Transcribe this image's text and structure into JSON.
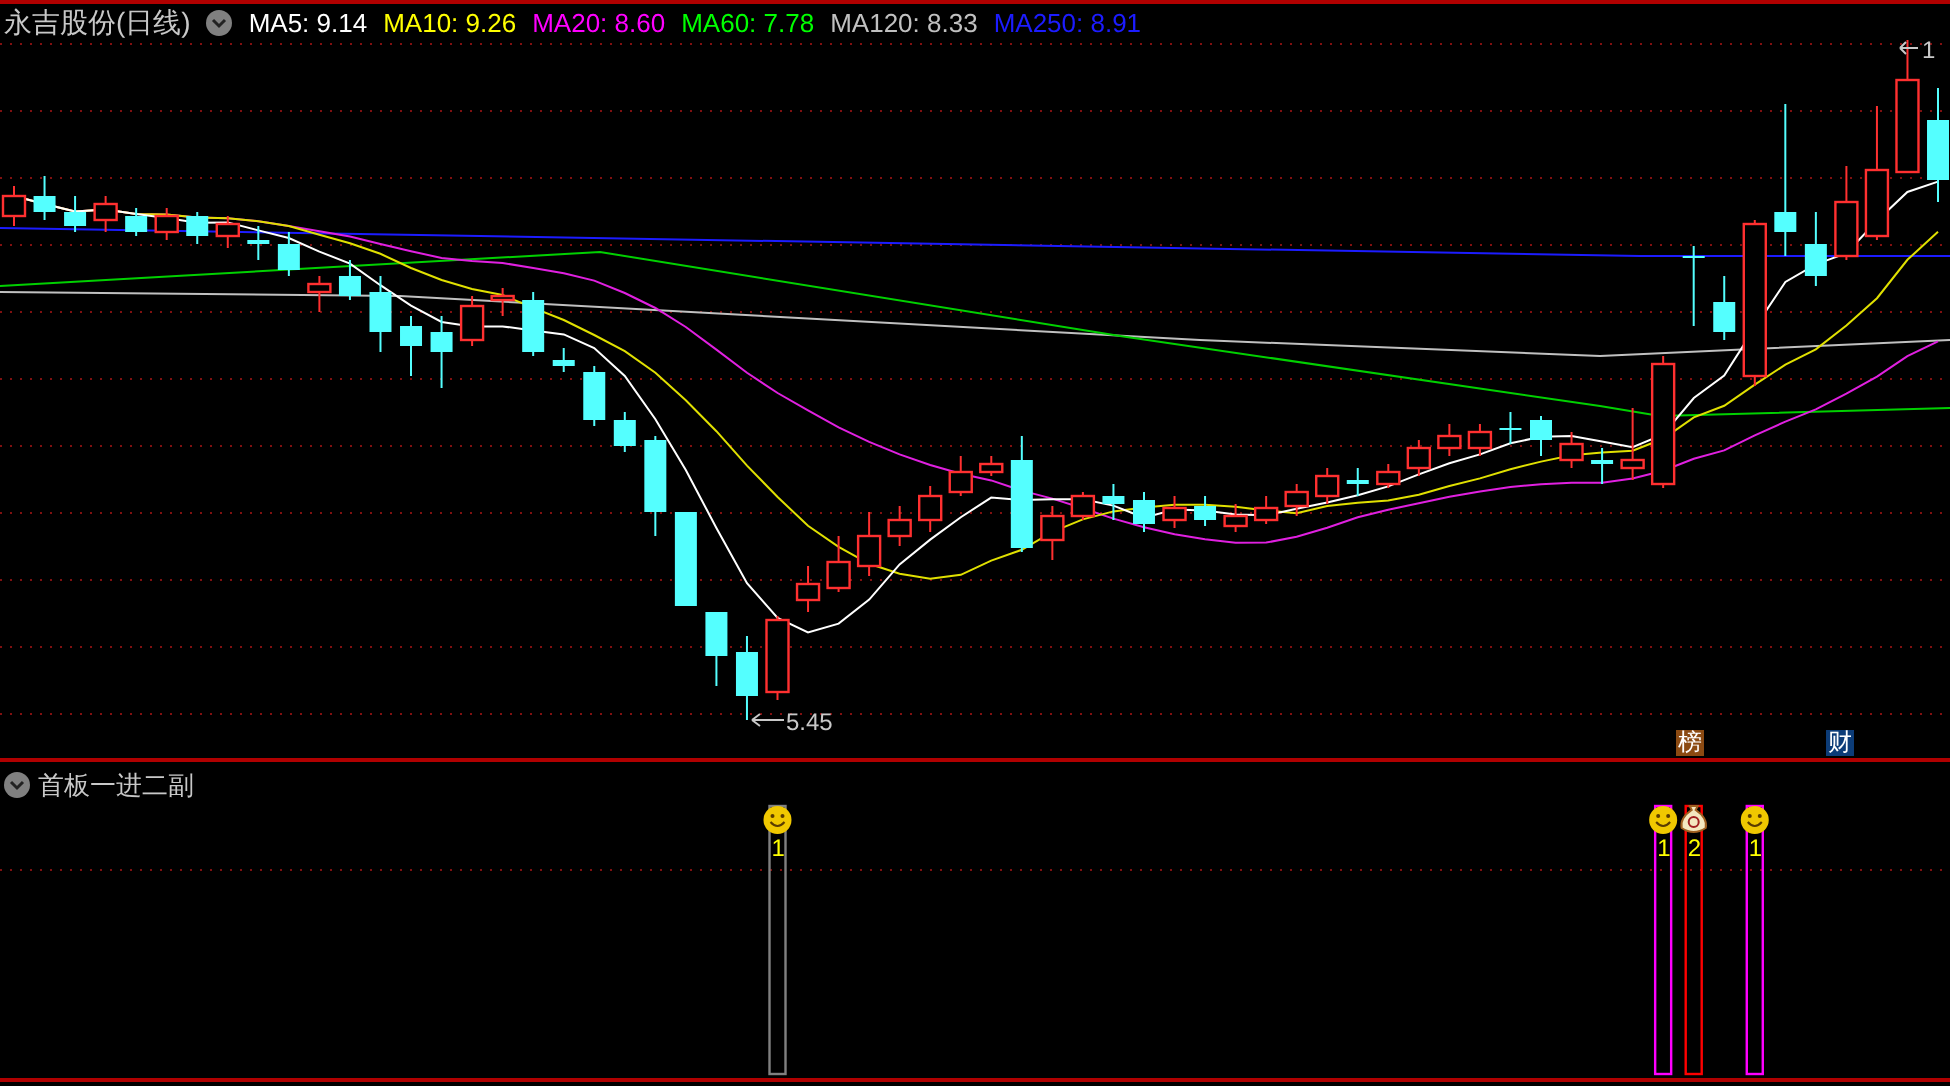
{
  "header": {
    "title": "永吉股份(日线)",
    "indicators": [
      {
        "label": "MA5:",
        "value": "9.14",
        "color": "#ffffff"
      },
      {
        "label": "MA10:",
        "value": "9.26",
        "color": "#ffff00"
      },
      {
        "label": "MA20:",
        "value": "8.60",
        "color": "#ff00ff"
      },
      {
        "label": "MA60:",
        "value": "7.78",
        "color": "#00ff00"
      },
      {
        "label": "MA120:",
        "value": "8.33",
        "color": "#c0c0c0"
      },
      {
        "label": "MA250:",
        "value": "8.91",
        "color": "#1c1cff"
      }
    ]
  },
  "main_chart": {
    "low_label": "5.45",
    "high_label": "1",
    "markers": [
      {
        "label": "榜",
        "color": "#8b4a12"
      },
      {
        "label": "财",
        "color": "#0c3c78"
      }
    ]
  },
  "sub_panel": {
    "title": "首板一进二副",
    "signals": [
      {
        "kind": "smiley",
        "label": "1",
        "color": "#808080"
      },
      {
        "kind": "smiley",
        "label": "1",
        "color": "#ff00ff"
      },
      {
        "kind": "money-bag",
        "label": "2",
        "color": "#ff0000"
      },
      {
        "kind": "smiley",
        "label": "1",
        "color": "#ff00ff"
      }
    ]
  }
}
